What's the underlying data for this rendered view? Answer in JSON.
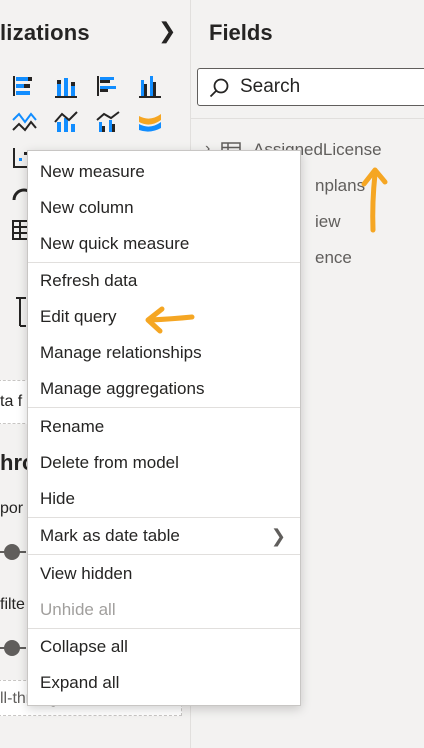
{
  "visualizations": {
    "title": "lizations",
    "collapse_icon": "chevron-right-icon",
    "left_texts": {
      "data_field": "ta f",
      "drill_heading": "hro",
      "report_text": "por",
      "filter_text": "filte",
      "drillthrough_placeholder": "ll-through fields here"
    }
  },
  "fields": {
    "title": "Fields",
    "search": {
      "placeholder": "Search"
    },
    "tables": [
      {
        "name": "AssignedLicense"
      },
      {
        "name": "nplans"
      },
      {
        "name": "iew"
      },
      {
        "name": "ence"
      }
    ]
  },
  "context_menu": {
    "items": [
      {
        "label": "New measure",
        "disabled": false
      },
      {
        "label": "New column",
        "disabled": false
      },
      {
        "label": "New quick measure",
        "disabled": false
      },
      {
        "label": "Refresh data",
        "disabled": false
      },
      {
        "label": "Edit query",
        "disabled": false
      },
      {
        "label": "Manage relationships",
        "disabled": false
      },
      {
        "label": "Manage aggregations",
        "disabled": false
      },
      {
        "label": "Rename",
        "disabled": false
      },
      {
        "label": "Delete from model",
        "disabled": false
      },
      {
        "label": "Hide",
        "disabled": false
      },
      {
        "label": "Mark as date table",
        "disabled": false,
        "submenu": true
      },
      {
        "label": "View hidden",
        "disabled": false
      },
      {
        "label": "Unhide all",
        "disabled": true
      },
      {
        "label": "Collapse all",
        "disabled": false
      },
      {
        "label": "Expand all",
        "disabled": false
      }
    ]
  },
  "colors": {
    "accent_blue": "#118dff",
    "annotation_orange": "#f5a623",
    "background": "#f3f2f1"
  }
}
